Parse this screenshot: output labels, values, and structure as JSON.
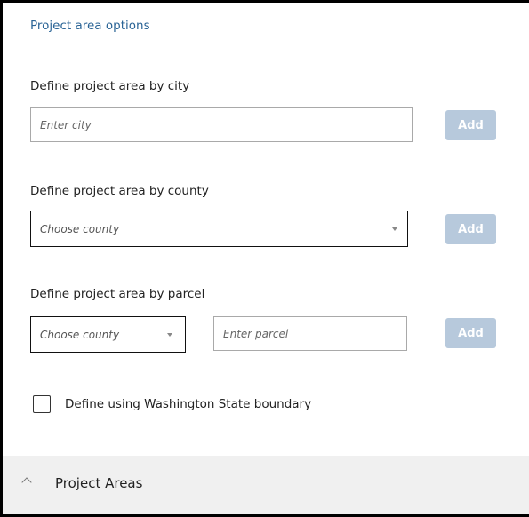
{
  "panel": {
    "title": "Project area options"
  },
  "city": {
    "label": "Define project area by city",
    "placeholder": "Enter city",
    "add_label": "Add"
  },
  "county": {
    "label": "Define project area by county",
    "selected": "Choose county",
    "add_label": "Add"
  },
  "parcel": {
    "label": "Define project area by parcel",
    "county_selected": "Choose county",
    "parcel_placeholder": "Enter parcel",
    "add_label": "Add"
  },
  "state_boundary": {
    "label": "Define using Washington State boundary",
    "checked": false
  },
  "accordion": {
    "title": "Project Areas",
    "expanded": true
  },
  "colors": {
    "title_link": "#2a6496",
    "add_button_disabled": "#b7c9dc",
    "accordion_bg": "#f0f0f0"
  },
  "icons": {
    "select_caret": "caret-down-icon",
    "accordion_toggle": "chevron-up-icon"
  }
}
